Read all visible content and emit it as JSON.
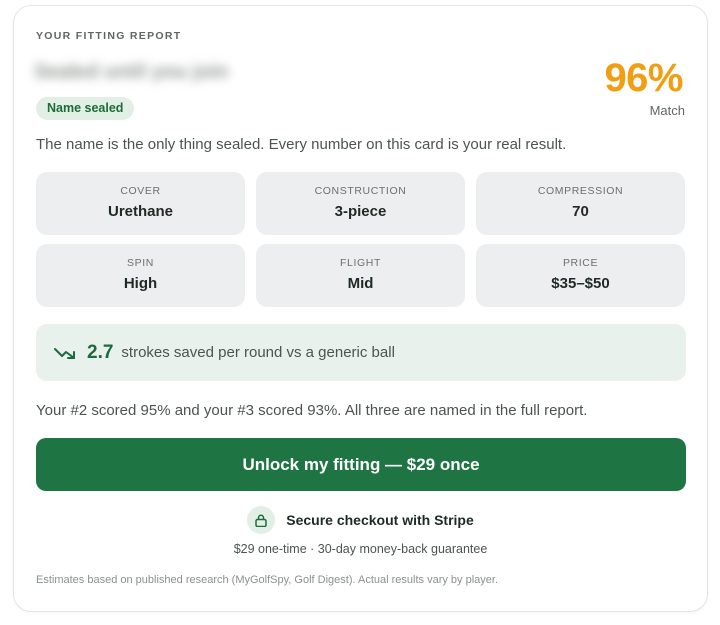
{
  "report": {
    "eyebrow": "YOUR FITTING REPORT",
    "sealed_name": "Sealed until you join",
    "badge": "Name sealed",
    "match_percent": "96%",
    "match_label": "Match",
    "intro": "The name is the only thing sealed. Every number on this card is your real result."
  },
  "stats": [
    {
      "label": "COVER",
      "value": "Urethane"
    },
    {
      "label": "CONSTRUCTION",
      "value": "3-piece"
    },
    {
      "label": "COMPRESSION",
      "value": "70"
    },
    {
      "label": "SPIN",
      "value": "High"
    },
    {
      "label": "FLIGHT",
      "value": "Mid"
    },
    {
      "label": "PRICE",
      "value": "$35–$50"
    }
  ],
  "savings": {
    "icon": "trending-down-icon",
    "value": "2.7",
    "text": "strokes saved per round vs a generic ball"
  },
  "ranking_text": "Your #2 scored 95% and your #3 scored 93%. All three are named in the full report.",
  "cta": {
    "label": "Unlock my fitting — $29 once"
  },
  "checkout": {
    "icon": "lock-icon",
    "secure_text": "Secure checkout with Stripe",
    "guarantee": "$29 one-time · 30-day money-back guarantee"
  },
  "disclaimer": "Estimates based on published research (MyGolfSpy, Golf Digest). Actual results vary by player.",
  "colors": {
    "accent_green": "#1e7543",
    "match_orange": "#f29e12",
    "badge_bg": "#e2efe5",
    "tile_bg": "#eceef0"
  }
}
